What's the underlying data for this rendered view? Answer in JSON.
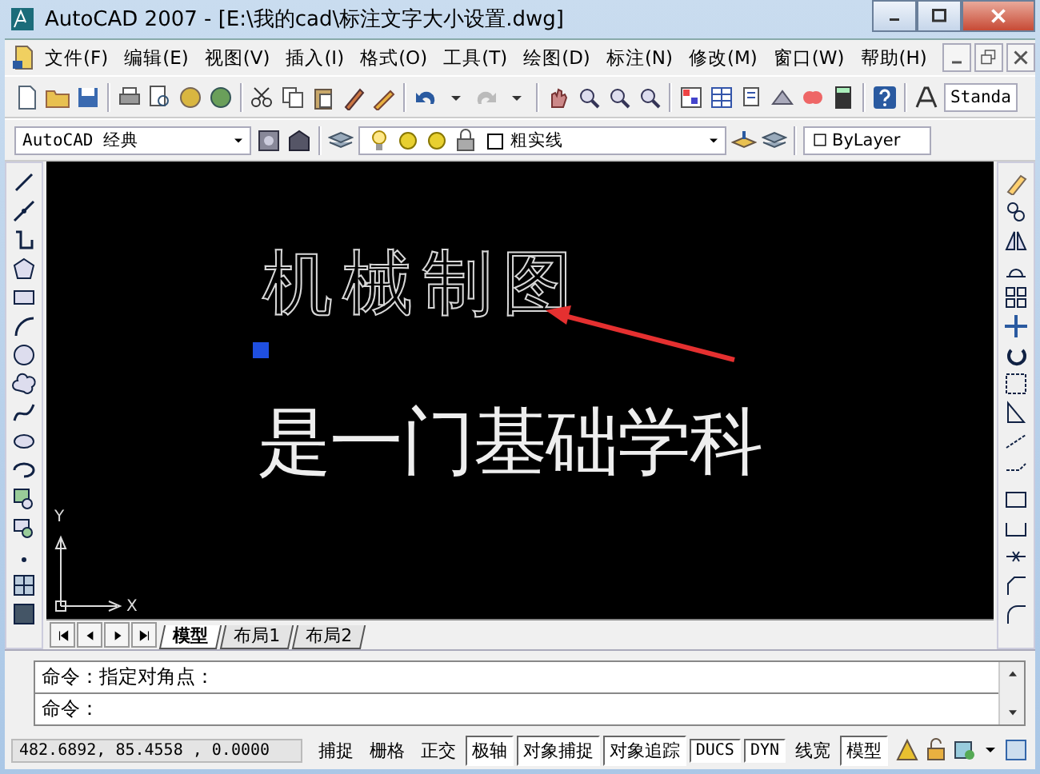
{
  "window": {
    "title": "AutoCAD 2007 - [E:\\我的cad\\标注文字大小设置.dwg]"
  },
  "menu": [
    "文件(F)",
    "编辑(E)",
    "视图(V)",
    "插入(I)",
    "格式(O)",
    "工具(T)",
    "绘图(D)",
    "标注(N)",
    "修改(M)",
    "窗口(W)",
    "帮助(H)"
  ],
  "toolbar": {
    "text_style": "Standa",
    "workspace": "AutoCAD 经典",
    "layer": "粗实线",
    "color_value": "ByLayer"
  },
  "drawing": {
    "texts": [
      {
        "text": "机械制图",
        "selected": true
      },
      {
        "text": "是一门基础学科",
        "selected": false
      }
    ],
    "axis_y": "Y",
    "axis_x": "X"
  },
  "layout_tabs": [
    {
      "label": "模型",
      "selected": true
    },
    {
      "label": "布局1",
      "selected": false
    },
    {
      "label": "布局2",
      "selected": false
    }
  ],
  "command_lines": [
    "命令：指定对角点：",
    "命令："
  ],
  "status_bar": {
    "coordinates": "482.6892, 85.4558 , 0.0000",
    "toggles": [
      {
        "label": "捕捉",
        "on": false
      },
      {
        "label": "栅格",
        "on": false
      },
      {
        "label": "正交",
        "on": false
      },
      {
        "label": "极轴",
        "on": true
      },
      {
        "label": "对象捕捉",
        "on": true
      },
      {
        "label": "对象追踪",
        "on": true
      },
      {
        "label": "DUCS",
        "on": true
      },
      {
        "label": "DYN",
        "on": true
      },
      {
        "label": "线宽",
        "on": false
      },
      {
        "label": "模型",
        "on": true
      }
    ]
  }
}
